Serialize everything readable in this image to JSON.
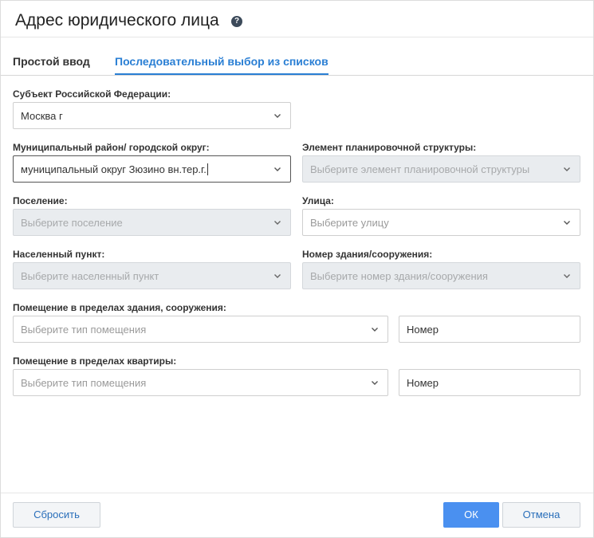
{
  "dialog": {
    "title": "Адрес юридического лица",
    "help_icon": "?"
  },
  "tabs": [
    {
      "label": "Простой ввод",
      "active": false
    },
    {
      "label": "Последовательный выбор из списков",
      "active": true
    }
  ],
  "form": {
    "subject": {
      "label": "Субъект Российской Федерации:",
      "value": "Москва г"
    },
    "municipal": {
      "label": "Муниципальный район/ городской округ:",
      "value": "муниципальный округ Зюзино вн.тер.г."
    },
    "planning_element": {
      "label": "Элемент планировочной структуры:",
      "placeholder": "Выберите элемент планировочной структуры"
    },
    "settlement": {
      "label": "Поселение:",
      "placeholder": "Выберите поселение"
    },
    "street": {
      "label": "Улица:",
      "placeholder": "Выберите улицу"
    },
    "locality": {
      "label": "Населенный пункт:",
      "placeholder": "Выберите населенный пункт"
    },
    "building": {
      "label": "Номер здания/сооружения:",
      "placeholder": "Выберите номер здания/сооружения"
    },
    "room_building": {
      "label": "Помещение в пределах здания, сооружения:",
      "type_placeholder": "Выберите тип помещения",
      "number_placeholder": "Номер"
    },
    "room_apartment": {
      "label": "Помещение в пределах квартиры:",
      "type_placeholder": "Выберите тип помещения",
      "number_placeholder": "Номер"
    }
  },
  "footer": {
    "reset_label": "Сбросить",
    "ok_label": "ОК",
    "cancel_label": "Отмена"
  },
  "colors": {
    "accent": "#2a7fd4",
    "primary_button": "#4a90f0",
    "disabled_bg": "#e9ecef"
  },
  "icons": {
    "help": "question-circle-icon",
    "dropdown": "chevron-down-icon"
  }
}
